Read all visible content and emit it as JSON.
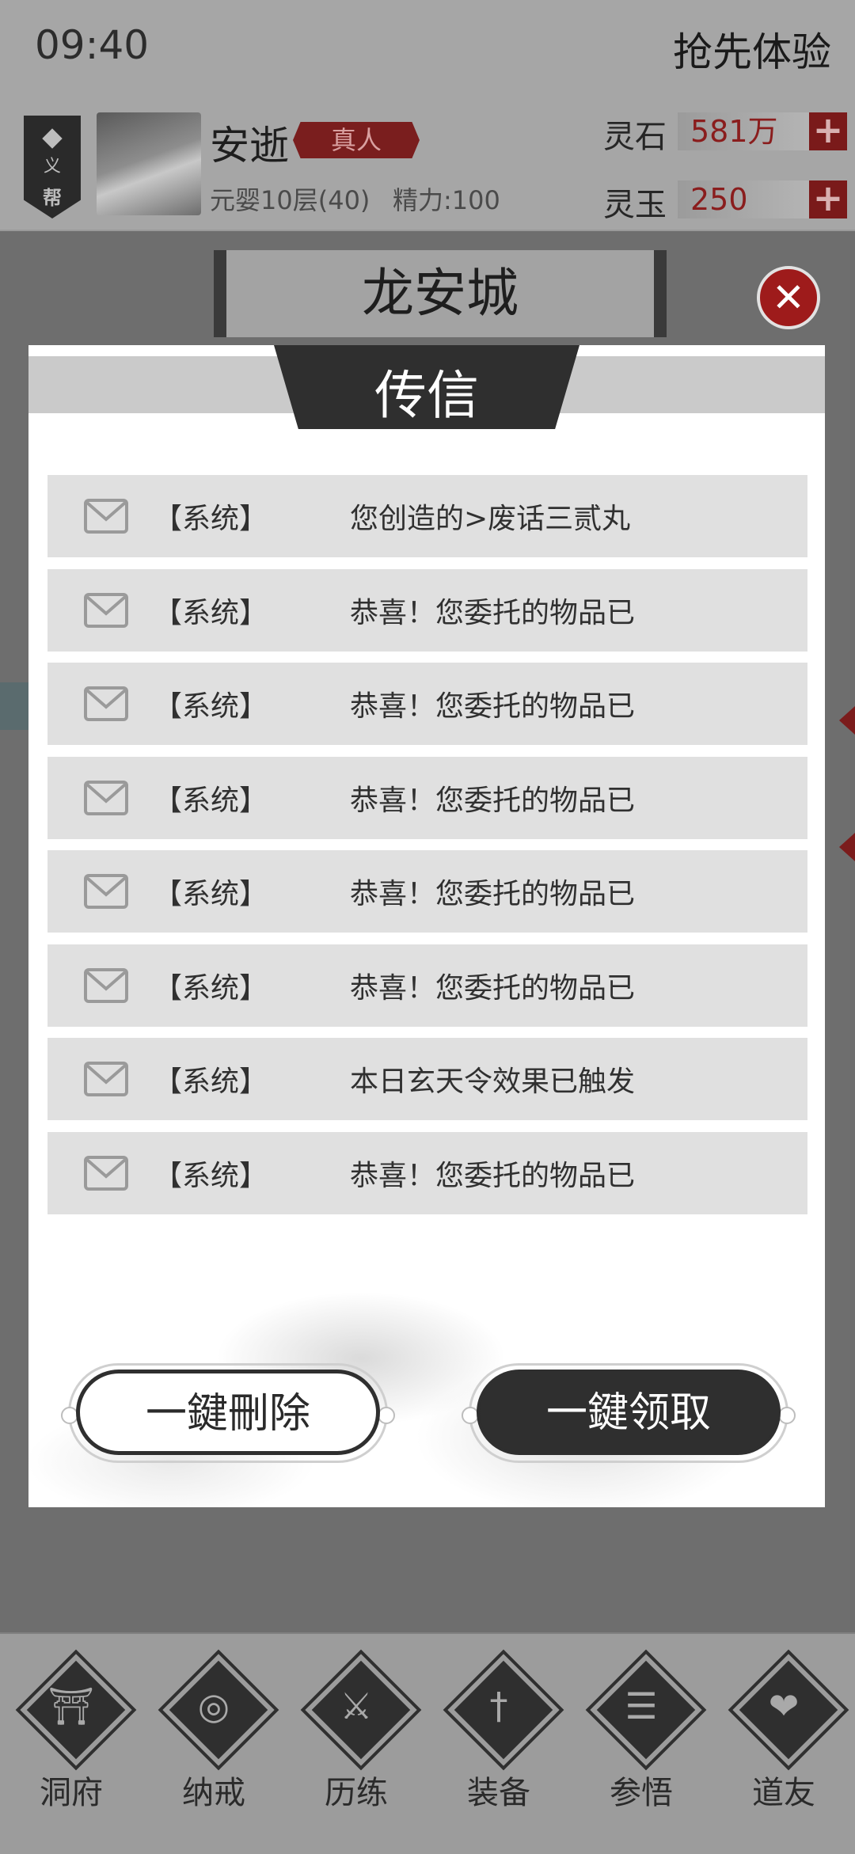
{
  "status_bar": {
    "time": "09:40"
  },
  "header": {
    "promo": "抢先体验",
    "guild_badge": {
      "top": "义",
      "bottom": "帮"
    },
    "player": {
      "name": "安逝",
      "badge": "真人",
      "level": "元婴10层(40)",
      "energy": "精力:100"
    },
    "resources": [
      {
        "label": "灵石",
        "value": "581万",
        "plus": "+"
      },
      {
        "label": "灵玉",
        "value": "250",
        "plus": "+"
      }
    ]
  },
  "location": {
    "city": "龙安城",
    "close_symbol": "✕"
  },
  "modal": {
    "title": "传信",
    "messages": [
      {
        "sender": "【系统】",
        "subject": "您创造的>废话三贰丸"
      },
      {
        "sender": "【系统】",
        "subject": "恭喜！您委托的物品已"
      },
      {
        "sender": "【系统】",
        "subject": "恭喜！您委托的物品已"
      },
      {
        "sender": "【系统】",
        "subject": "恭喜！您委托的物品已"
      },
      {
        "sender": "【系统】",
        "subject": "恭喜！您委托的物品已"
      },
      {
        "sender": "【系统】",
        "subject": "恭喜！您委托的物品已"
      },
      {
        "sender": "【系统】",
        "subject": "本日玄天令效果已触发"
      },
      {
        "sender": "【系统】",
        "subject": "恭喜！您委托的物品已"
      }
    ],
    "delete_all_label": "一鍵刪除",
    "claim_all_label": "一鍵领取"
  },
  "bottom_nav": [
    {
      "label": "洞府",
      "icon": "gate-icon"
    },
    {
      "label": "纳戒",
      "icon": "ring-icon"
    },
    {
      "label": "历练",
      "icon": "crossed-swords-icon"
    },
    {
      "label": "装备",
      "icon": "dagger-icon"
    },
    {
      "label": "参悟",
      "icon": "book-icon"
    },
    {
      "label": "道友",
      "icon": "handshake-icon"
    }
  ],
  "colors": {
    "accent_red": "#9e1b1b",
    "dark": "#2f2f2f",
    "row_bg": "#e0e0e0"
  }
}
